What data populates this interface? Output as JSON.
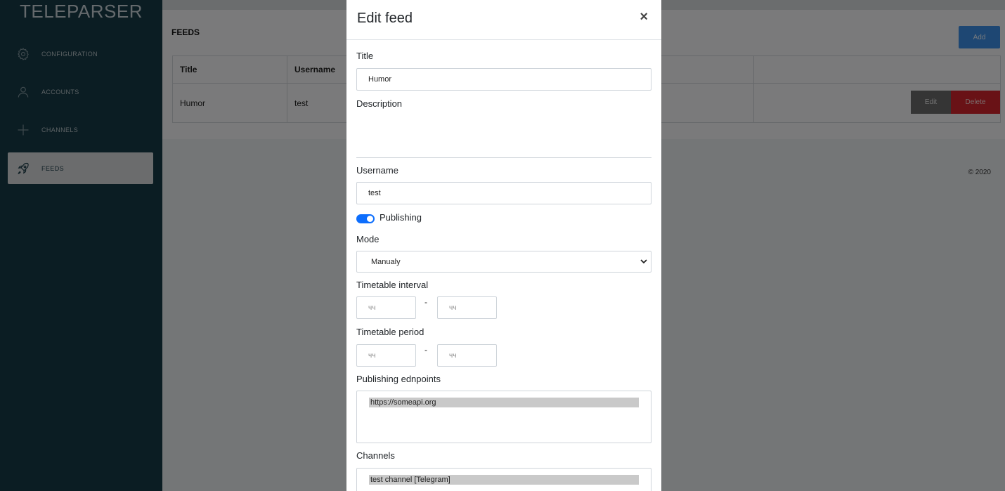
{
  "app": {
    "brand": "TELEPARSER"
  },
  "sidebar": {
    "items": [
      {
        "label": "CONFIGURATION",
        "icon": "gear-icon",
        "active": false
      },
      {
        "label": "ACCOUNTS",
        "icon": "user-icon",
        "active": false
      },
      {
        "label": "CHANNELS",
        "icon": "plus-icon",
        "active": false
      },
      {
        "label": "FEEDS",
        "icon": "rocket-icon",
        "active": true
      }
    ]
  },
  "main": {
    "title": "FEEDS",
    "add_label": "Add",
    "table": {
      "headers": [
        "Title",
        "Username",
        "",
        ""
      ],
      "rows": [
        {
          "title": "Humor",
          "username": "test"
        }
      ]
    },
    "edit_label": "Edit",
    "delete_label": "Delete",
    "copyright": "© 2020"
  },
  "modal": {
    "title": "Edit feed",
    "close_label": "×",
    "fields": {
      "title_label": "Title",
      "title_value": "Humor",
      "description_label": "Description",
      "username_label": "Username",
      "username_value": "test",
      "publishing_label": "Publishing",
      "publishing_on": true,
      "mode_label": "Mode",
      "mode_value": "Manualy",
      "timetable_interval_label": "Timetable interval",
      "timetable_interval_from_placeholder": "чч",
      "timetable_interval_to_placeholder": "чч",
      "timetable_period_label": "Timetable period",
      "timetable_period_from_placeholder": "чч",
      "timetable_period_to_placeholder": "чч",
      "range_separator": "-",
      "endpoints_label": "Publishing ednpoints",
      "endpoints_options": [
        "https://someapi.org"
      ],
      "channels_label": "Channels",
      "channels_options": [
        "test channel [Telegram]"
      ]
    }
  },
  "colors": {
    "sidebar_bg": "#173a47",
    "primary": "#0d6efd",
    "add_button": "#3d8fe6",
    "delete_button": "#d3242d",
    "edit_button": "#6b6b6b"
  }
}
